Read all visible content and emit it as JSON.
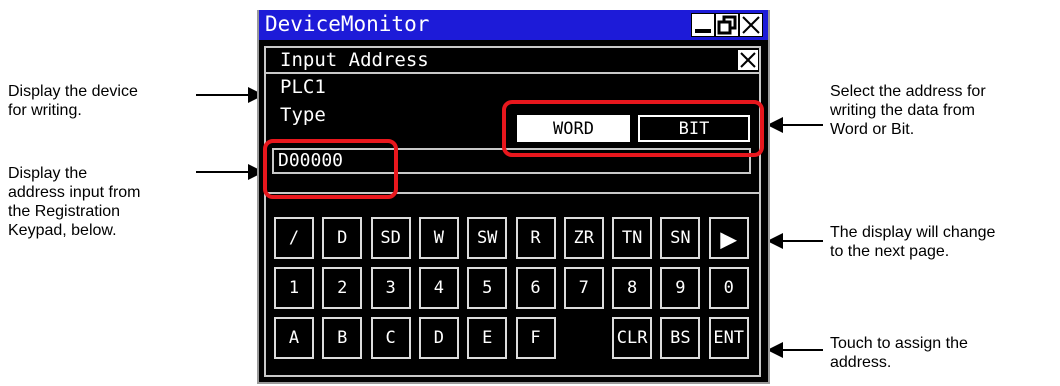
{
  "window": {
    "title": "DeviceMonitor"
  },
  "dialog": {
    "title": "Input Address",
    "device": "PLC1",
    "type_label": "Type",
    "type_options": [
      "WORD",
      "BIT"
    ],
    "selected_type": "WORD",
    "address_value": "D00000"
  },
  "keypad": {
    "rows": [
      [
        "/",
        "D",
        "SD",
        "W",
        "SW",
        "R",
        "ZR",
        "TN",
        "SN",
        "▶"
      ],
      [
        "1",
        "2",
        "3",
        "4",
        "5",
        "6",
        "7",
        "8",
        "9",
        "0"
      ],
      [
        "A",
        "B",
        "C",
        "D",
        "E",
        "F",
        "",
        "CLR",
        "BS",
        "ENT"
      ]
    ]
  },
  "annotations": {
    "display_device": "Display the device\nfor writing.",
    "display_address": "Display the\naddress input from\nthe Registration\nKeypad, below.",
    "select_type": "Select the address for\nwriting the data from\nWord or Bit.",
    "next_page": "The display will change\nto the next page.",
    "assign": "Touch to assign the\naddress."
  },
  "colors": {
    "titlebar": "#1d1bd8",
    "highlight": "#e8171d"
  }
}
